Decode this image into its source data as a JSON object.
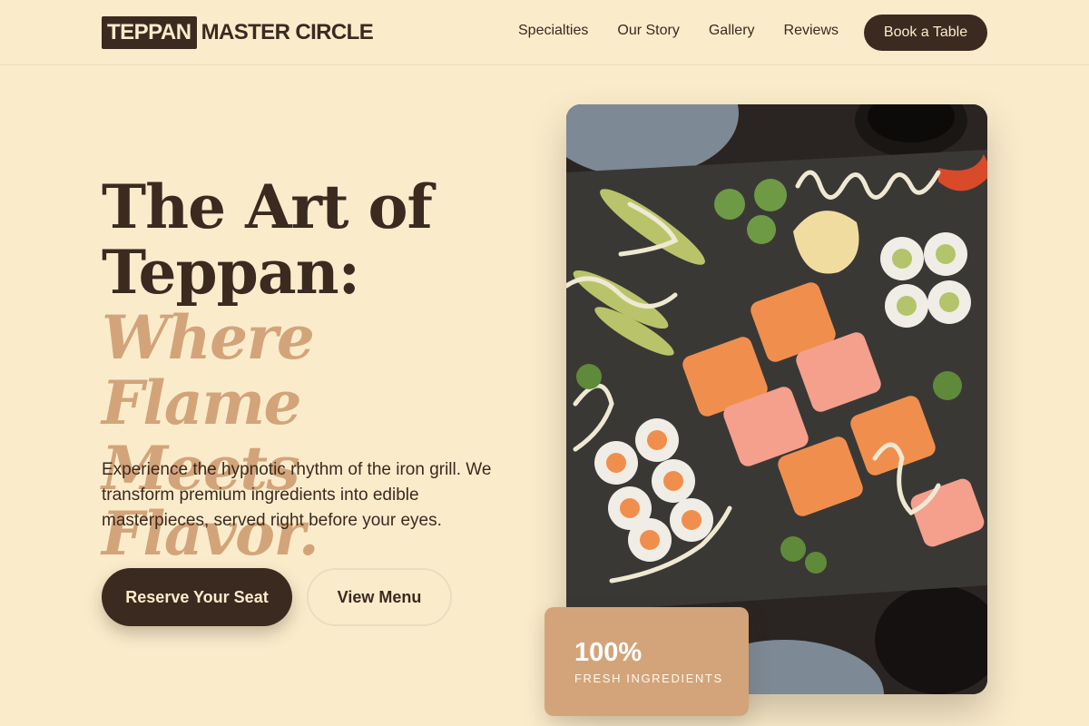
{
  "brand": {
    "logo_box": "TEPPAN",
    "logo_text": "MASTER CIRCLE"
  },
  "nav": {
    "items": [
      {
        "label": "Specialties"
      },
      {
        "label": "Our Story"
      },
      {
        "label": "Gallery"
      },
      {
        "label": "Reviews"
      }
    ],
    "cta": "Book a Table"
  },
  "hero": {
    "title_line1": "The Art of",
    "title_line2": "Teppan:",
    "accent_line1": "Where Flame",
    "accent_line2": "Meets Flavor.",
    "lead": "Experience the hypnotic rhythm of the iron grill. We transform premium ingredients into edible masterpieces, served right before your eyes.",
    "primary_cta": "Reserve Your Seat",
    "secondary_cta": "View Menu"
  },
  "stat": {
    "value": "100%",
    "label": "FRESH INGREDIENTS"
  },
  "colors": {
    "background": "#faeccb",
    "dark_brown": "#3b2a20",
    "accent_tan": "#d3a47a"
  },
  "icons": {
    "photo": "sushi-platter-image"
  }
}
